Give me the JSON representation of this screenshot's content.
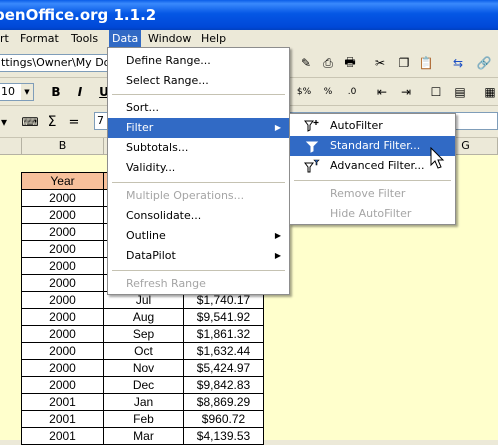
{
  "window": {
    "title": "penOffice.org 1.1.2"
  },
  "menubar": {
    "items": [
      "rt",
      "Format",
      "Tools",
      "Data",
      "Window",
      "Help"
    ],
    "active_index": 3
  },
  "toolbar": {
    "path_value": "ttings\\Owner\\My Do",
    "font_size": "10",
    "cell_ref_value": "7"
  },
  "columns": [
    "B",
    "G"
  ],
  "data_menu": {
    "items": [
      {
        "label": "Define Range...",
        "enabled": true,
        "submenu": false
      },
      {
        "label": "Select Range...",
        "enabled": true,
        "submenu": false
      },
      {
        "label": "Sort...",
        "enabled": true,
        "submenu": false
      },
      {
        "label": "Filter",
        "enabled": true,
        "submenu": true,
        "highlighted": true
      },
      {
        "label": "Subtotals...",
        "enabled": true,
        "submenu": false
      },
      {
        "label": "Validity...",
        "enabled": true,
        "submenu": false
      },
      {
        "label": "Multiple Operations...",
        "enabled": false,
        "submenu": false
      },
      {
        "label": "Consolidate...",
        "enabled": true,
        "submenu": false
      },
      {
        "label": "Outline",
        "enabled": true,
        "submenu": true
      },
      {
        "label": "DataPilot",
        "enabled": true,
        "submenu": true
      },
      {
        "label": "Refresh Range",
        "enabled": false,
        "submenu": false
      }
    ]
  },
  "filter_submenu": {
    "items": [
      {
        "label": "AutoFilter",
        "enabled": true,
        "icon": "autofilter-icon"
      },
      {
        "label": "Standard Filter...",
        "enabled": true,
        "highlighted": true,
        "icon": "standard-filter-icon"
      },
      {
        "label": "Advanced Filter...",
        "enabled": true,
        "icon": "advanced-filter-icon"
      },
      {
        "label": "Remove Filter",
        "enabled": false
      },
      {
        "label": "Hide AutoFilter",
        "enabled": false
      }
    ]
  },
  "table": {
    "header": [
      "Year",
      "",
      ""
    ],
    "rows": [
      [
        "2000",
        "",
        ""
      ],
      [
        "2000",
        "",
        ""
      ],
      [
        "2000",
        "",
        ""
      ],
      [
        "2000",
        "",
        ""
      ],
      [
        "2000",
        "",
        ""
      ],
      [
        "2000",
        "",
        ""
      ],
      [
        "2000",
        "Jul",
        "$1,740.17"
      ],
      [
        "2000",
        "Aug",
        "$9,541.92"
      ],
      [
        "2000",
        "Sep",
        "$1,861.32"
      ],
      [
        "2000",
        "Oct",
        "$1,632.44"
      ],
      [
        "2000",
        "Nov",
        "$5,424.97"
      ],
      [
        "2000",
        "Dec",
        "$9,842.83"
      ],
      [
        "2001",
        "Jan",
        "$8,869.29"
      ],
      [
        "2001",
        "Feb",
        "$960.72"
      ],
      [
        "2001",
        "Mar",
        "$4,139.53"
      ]
    ]
  },
  "colors": {
    "menu_highlight": "#316ac5",
    "header_fill": "#f7c09b",
    "sheet_bg": "#ffffcc"
  }
}
